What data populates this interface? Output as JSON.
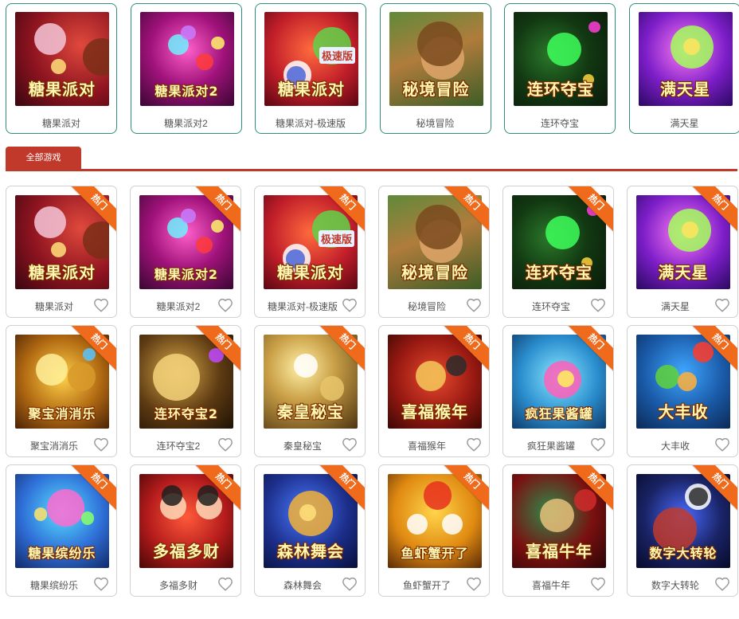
{
  "featured": [
    {
      "name": "糖果派对",
      "art": "糖果派对",
      "theme": "candy"
    },
    {
      "name": "糖果派对2",
      "art": "糖果派对2",
      "theme": "candy2"
    },
    {
      "name": "糖果派对-极速版",
      "art": "糖果派对",
      "art_badge": "极速版",
      "theme": "candy3"
    },
    {
      "name": "秘境冒险",
      "art": "秘境冒险",
      "theme": "jungle"
    },
    {
      "name": "连环夺宝",
      "art": "连环夺宝",
      "theme": "gem"
    },
    {
      "name": "满天星",
      "art": "满天星",
      "theme": "star"
    }
  ],
  "tab": {
    "label": "全部游戏",
    "accent": "#c0392b"
  },
  "ribbon_label": "热门",
  "grid": [
    {
      "name": "糖果派对",
      "art": "糖果派对",
      "theme": "candy"
    },
    {
      "name": "糖果派对2",
      "art": "糖果派对2",
      "theme": "candy2"
    },
    {
      "name": "糖果派对-极速版",
      "art": "糖果派对",
      "art_badge": "极速版",
      "theme": "candy3"
    },
    {
      "name": "秘境冒险",
      "art": "秘境冒险",
      "theme": "jungle"
    },
    {
      "name": "连环夺宝",
      "art": "连环夺宝",
      "theme": "gem"
    },
    {
      "name": "满天星",
      "art": "满天星",
      "theme": "star"
    },
    {
      "name": "聚宝消消乐",
      "art": "聚宝消消乐",
      "theme": "gold"
    },
    {
      "name": "连环夺宝2",
      "art": "连环夺宝2",
      "theme": "dragon"
    },
    {
      "name": "秦皇秘宝",
      "art": "秦皇秘宝",
      "theme": "qin"
    },
    {
      "name": "喜福猴年",
      "art": "喜福猴年",
      "theme": "monkey"
    },
    {
      "name": "疯狂果酱罐",
      "art": "疯狂果酱罐",
      "theme": "jam"
    },
    {
      "name": "大丰收",
      "art": "大丰收",
      "theme": "harvest"
    },
    {
      "name": "糖果缤纷乐",
      "art": "糖果缤纷乐",
      "theme": "candyfun"
    },
    {
      "name": "多福多财",
      "art": "多福多财",
      "theme": "fortune"
    },
    {
      "name": "森林舞会",
      "art": "森林舞会",
      "theme": "forest"
    },
    {
      "name": "鱼虾蟹开了",
      "art": "鱼虾蟹开了",
      "theme": "fish"
    },
    {
      "name": "喜福牛年",
      "art": "喜福牛年",
      "theme": "ox"
    },
    {
      "name": "数字大转轮",
      "art": "数字大转轮",
      "theme": "wheel"
    }
  ],
  "icons": {
    "favorite": "heart-outline-icon"
  }
}
